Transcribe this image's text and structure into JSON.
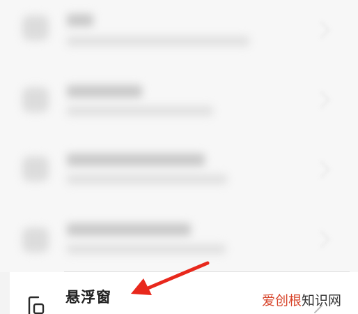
{
  "settings_list": {
    "blurred_rows_count": 4,
    "floating_window_item": {
      "label": "悬浮窗",
      "icon": "floating-window-icon",
      "chevron_icon": "chevron-right-icon"
    }
  },
  "annotation": {
    "icon": "red-arrow-pointer",
    "color": "#e8281c"
  },
  "watermark": {
    "brand": "爱创根",
    "suffix": "知识网",
    "brand_color": "#d7442a"
  },
  "colors": {
    "background": "#f7f7f7",
    "row_background": "#ffffff",
    "text_primary": "#222222",
    "separator": "#dedede"
  }
}
